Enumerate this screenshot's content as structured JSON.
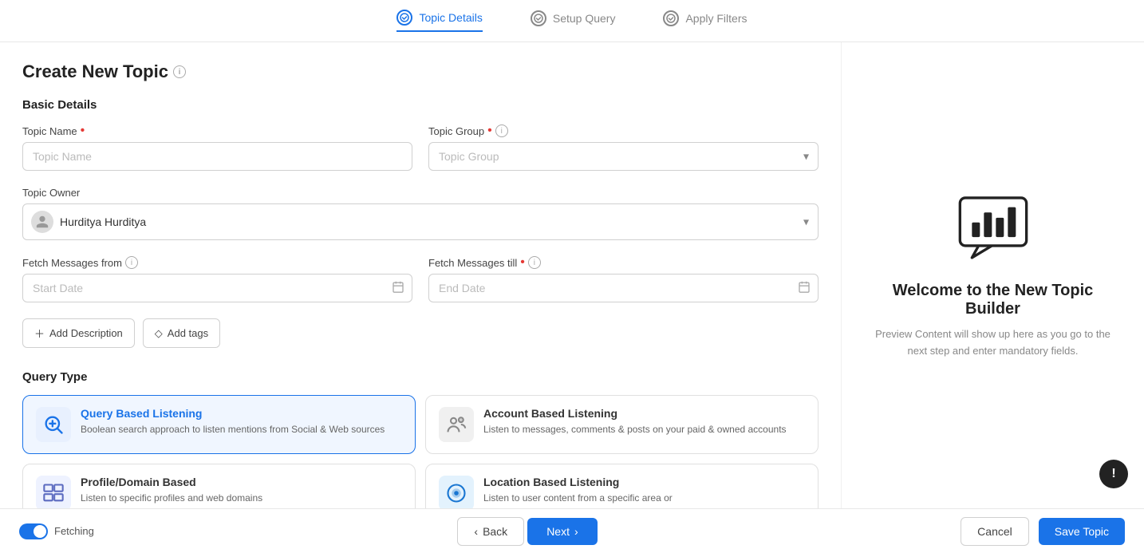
{
  "stepper": {
    "steps": [
      {
        "id": "topic-details",
        "label": "Topic Details",
        "state": "active",
        "icon": "✓"
      },
      {
        "id": "setup-query",
        "label": "Setup Query",
        "state": "default",
        "icon": "○"
      },
      {
        "id": "apply-filters",
        "label": "Apply Filters",
        "state": "default",
        "icon": "○"
      }
    ]
  },
  "page": {
    "title": "Create New Topic",
    "section_basic": "Basic Details",
    "section_query_type": "Query Type"
  },
  "form": {
    "topic_name_label": "Topic Name",
    "topic_name_placeholder": "Topic Name",
    "topic_group_label": "Topic Group",
    "topic_group_placeholder": "Topic Group",
    "topic_owner_label": "Topic Owner",
    "owner_name": "Hurditya Hurditya",
    "fetch_from_label": "Fetch Messages from",
    "fetch_till_label": "Fetch Messages till",
    "start_date_placeholder": "Start Date",
    "end_date_placeholder": "End Date",
    "add_description_label": "Add Description",
    "add_tags_label": "Add tags"
  },
  "query_types": [
    {
      "id": "query-based",
      "title": "Query Based Listening",
      "description": "Boolean search approach to listen mentions from Social & Web sources",
      "selected": true,
      "icon_type": "search"
    },
    {
      "id": "account-based",
      "title": "Account Based Listening",
      "description": "Listen to messages, comments & posts on your paid & owned accounts",
      "selected": false,
      "icon_type": "account"
    },
    {
      "id": "profile-domain",
      "title": "Profile/Domain Based",
      "description": "Listen to specific profiles and web domains",
      "selected": false,
      "icon_type": "profile"
    },
    {
      "id": "location-based",
      "title": "Location Based Listening",
      "description": "Listen to user content from a specific area or",
      "selected": false,
      "icon_type": "location"
    }
  ],
  "right_panel": {
    "title": "Welcome to the New Topic Builder",
    "description": "Preview Content will show up here as you go to the next step and enter mandatory fields."
  },
  "bottom_bar": {
    "toggle_label": "Fetching",
    "back_label": "Back",
    "next_label": "Next",
    "cancel_label": "Cancel",
    "save_label": "Save Topic"
  }
}
